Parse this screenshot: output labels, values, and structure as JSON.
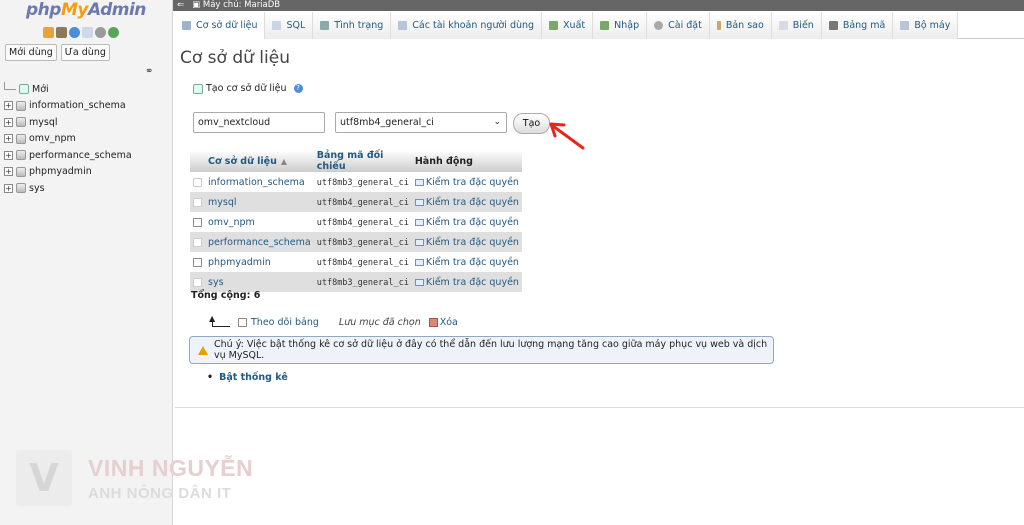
{
  "nav": {
    "logo": {
      "php": "php",
      "my": "My",
      "admin": "Admin"
    },
    "buttons": {
      "recent": "Mới dùng",
      "favorites": "Ưa dùng"
    },
    "tree": [
      "Mới",
      "information_schema",
      "mysql",
      "omv_npm",
      "performance_schema",
      "phpmyadmin",
      "sys"
    ]
  },
  "topbar": {
    "server": "Máy chủ: MariaDB"
  },
  "tabs": [
    {
      "label": "Cơ sở dữ liệu",
      "icon": "database-icon"
    },
    {
      "label": "SQL",
      "icon": "sql-icon"
    },
    {
      "label": "Tình trạng",
      "icon": "status-icon"
    },
    {
      "label": "Các tài khoản người dùng",
      "icon": "users-icon"
    },
    {
      "label": "Xuất",
      "icon": "export-icon"
    },
    {
      "label": "Nhập",
      "icon": "import-icon"
    },
    {
      "label": "Cài đặt",
      "icon": "settings-icon"
    },
    {
      "label": "Bản sao",
      "icon": "replication-icon"
    },
    {
      "label": "Biến",
      "icon": "variables-icon"
    },
    {
      "label": "Bảng mã",
      "icon": "charset-icon"
    },
    {
      "label": "Bộ máy",
      "icon": "engines-icon"
    }
  ],
  "main": {
    "title": "Cơ sở dữ liệu",
    "create_heading": "Tạo cơ sở dữ liệu",
    "db_name_value": "omv_nextcloud",
    "collation_value": "utf8mb4_general_ci",
    "create_button": "Tạo",
    "columns": {
      "db": "Cơ sở dữ liệu",
      "collation": "Bảng mã đối chiếu",
      "action": "Hành động"
    },
    "rows": [
      {
        "db": "information_schema",
        "collation": "utf8mb3_general_ci",
        "action": "Kiểm tra đặc quyền"
      },
      {
        "db": "mysql",
        "collation": "utf8mb4_general_ci",
        "action": "Kiểm tra đặc quyền"
      },
      {
        "db": "omv_npm",
        "collation": "utf8mb4_general_ci",
        "action": "Kiểm tra đặc quyền"
      },
      {
        "db": "performance_schema",
        "collation": "utf8mb3_general_ci",
        "action": "Kiểm tra đặc quyền"
      },
      {
        "db": "phpmyadmin",
        "collation": "utf8mb4_general_ci",
        "action": "Kiểm tra đặc quyền"
      },
      {
        "db": "sys",
        "collation": "utf8mb3_general_ci",
        "action": "Kiểm tra đặc quyền"
      }
    ],
    "total": "Tổng cộng: 6",
    "select_all": "Theo dõi bảng",
    "with_selected": "Lưu mục đã chọn",
    "drop": "Xóa",
    "notice": "Chú ý: Việc bật thống kê cơ sở dữ liệu ở đây có thể dẫn đến lưu lượng mạng tăng cao giữa máy phục vụ web và dịch vụ MySQL.",
    "enable_stats": "Bật thống kê"
  },
  "watermark": {
    "line1": "VINH NGUYỄN",
    "line2": "ANH NÔNG DÂN IT"
  }
}
